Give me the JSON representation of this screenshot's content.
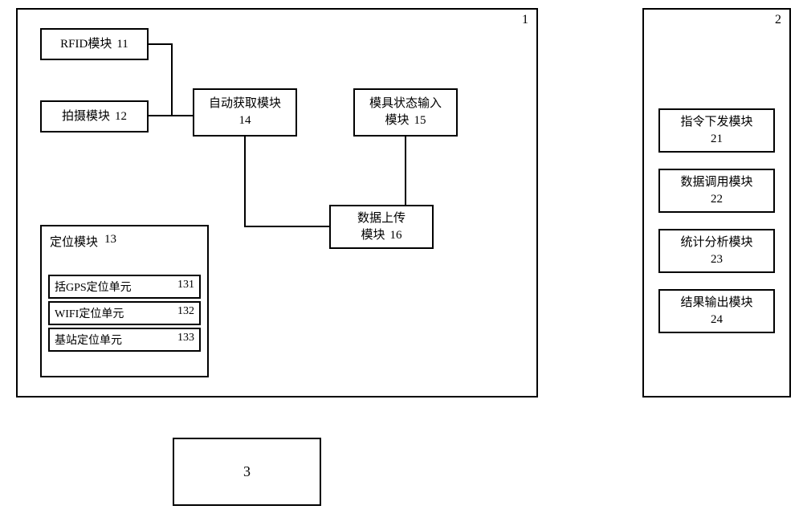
{
  "container1": {
    "label": "1",
    "modules": {
      "rfid": {
        "text": "RFID模块",
        "num": "11"
      },
      "camera": {
        "text": "拍摄模块",
        "num": "12"
      },
      "position": {
        "text": "定位模块",
        "num": "13"
      },
      "auto": {
        "text": "自动获取模块",
        "num": "14"
      },
      "status": {
        "text": "模具状态输入",
        "text2": "模块",
        "num": "15"
      },
      "upload": {
        "text": "数据上传",
        "text2": "模块",
        "num": "16"
      },
      "gps": {
        "text": "括GPS定位单元",
        "num": "131"
      },
      "wifi": {
        "text": "WIFI定位单元",
        "num": "132"
      },
      "base": {
        "text": "基站定位单元",
        "num": "133"
      }
    }
  },
  "container2": {
    "label": "2",
    "modules": {
      "cmd": {
        "text": "指令下发模块",
        "num": "21"
      },
      "data": {
        "text": "数据调用模块",
        "num": "22"
      },
      "stat": {
        "text": "统计分析模块",
        "num": "23"
      },
      "output": {
        "text": "结果输出模块",
        "num": "24"
      }
    }
  },
  "block3": {
    "label": "3"
  }
}
